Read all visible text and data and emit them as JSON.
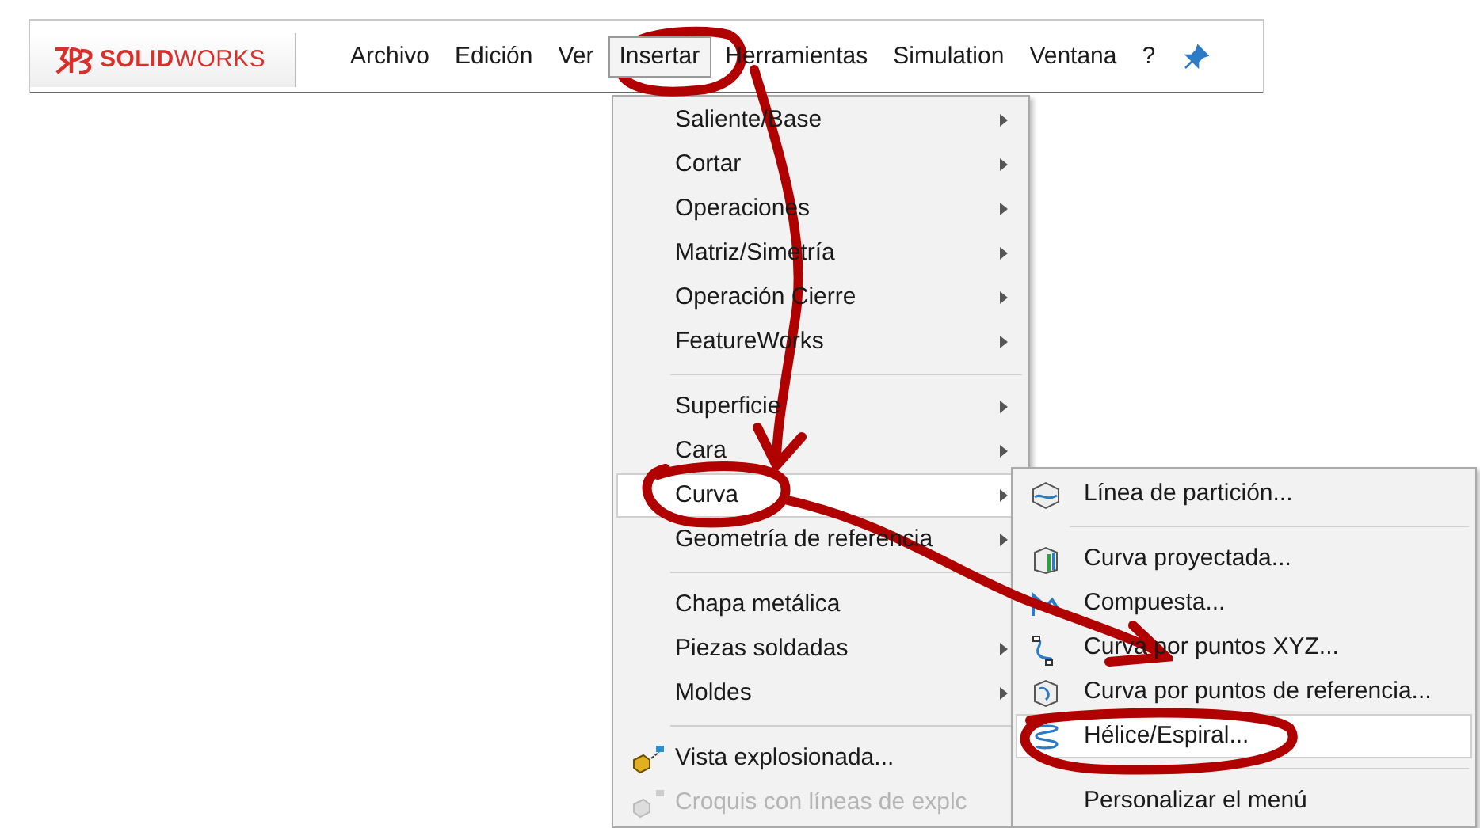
{
  "menubar": {
    "brand": "**SOLID**WORKS",
    "items": [
      {
        "label": "Archivo",
        "selected": false
      },
      {
        "label": "Edición",
        "selected": false
      },
      {
        "label": "Ver",
        "selected": false
      },
      {
        "label": "Insertar",
        "selected": true
      },
      {
        "label": "Herramientas",
        "selected": false
      },
      {
        "label": "Simulation",
        "selected": false
      },
      {
        "label": "Ventana",
        "selected": false
      },
      {
        "label": "?",
        "selected": false
      }
    ]
  },
  "insert_menu": {
    "items": [
      {
        "kind": "item",
        "label": "Saliente/Base",
        "submenu": true,
        "selected": false,
        "disabled": false
      },
      {
        "kind": "item",
        "label": "Cortar",
        "submenu": true,
        "selected": false,
        "disabled": false
      },
      {
        "kind": "item",
        "label": "Operaciones",
        "submenu": true,
        "selected": false,
        "disabled": false
      },
      {
        "kind": "item",
        "label": "Matriz/Simetría",
        "submenu": true,
        "selected": false,
        "disabled": false
      },
      {
        "kind": "item",
        "label": "Operación Cierre",
        "submenu": true,
        "selected": false,
        "disabled": false
      },
      {
        "kind": "item",
        "label": "FeatureWorks",
        "submenu": true,
        "selected": false,
        "disabled": false
      },
      {
        "kind": "separator"
      },
      {
        "kind": "item",
        "label": "Superficie",
        "submenu": true,
        "selected": false,
        "disabled": false
      },
      {
        "kind": "item",
        "label": "Cara",
        "submenu": true,
        "selected": false,
        "disabled": false
      },
      {
        "kind": "item",
        "label": "Curva",
        "submenu": true,
        "selected": true,
        "disabled": false
      },
      {
        "kind": "item",
        "label": "Geometría de referencia",
        "submenu": true,
        "selected": false,
        "disabled": false
      },
      {
        "kind": "separator"
      },
      {
        "kind": "item",
        "label": "Chapa metálica",
        "submenu": false,
        "selected": false,
        "disabled": false
      },
      {
        "kind": "item",
        "label": "Piezas soldadas",
        "submenu": true,
        "selected": false,
        "disabled": false
      },
      {
        "kind": "item",
        "label": "Moldes",
        "submenu": true,
        "selected": false,
        "disabled": false
      },
      {
        "kind": "separator"
      },
      {
        "kind": "item",
        "label": "Vista explosionada...",
        "submenu": false,
        "selected": false,
        "disabled": false
      },
      {
        "kind": "item",
        "label": "Croquis con líneas de explc",
        "submenu": false,
        "selected": false,
        "disabled": true
      }
    ]
  },
  "curve_menu": {
    "items": [
      {
        "kind": "item",
        "label": "Línea de partición...",
        "selected": false
      },
      {
        "kind": "separator"
      },
      {
        "kind": "item",
        "label": "Curva proyectada...",
        "selected": false
      },
      {
        "kind": "item",
        "label": "Compuesta...",
        "selected": false
      },
      {
        "kind": "item",
        "label": "Curva por puntos XYZ...",
        "selected": false
      },
      {
        "kind": "item",
        "label": "Curva por puntos de referencia...",
        "selected": false
      },
      {
        "kind": "item",
        "label": "Hélice/Espiral...",
        "selected": true
      },
      {
        "kind": "separator"
      },
      {
        "kind": "item",
        "label": "Personalizar el menú",
        "selected": false
      }
    ]
  }
}
